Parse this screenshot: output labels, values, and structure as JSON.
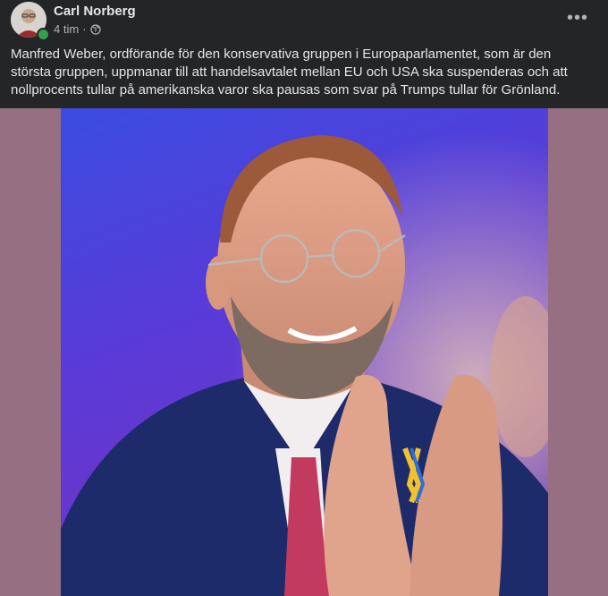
{
  "post": {
    "author": "Carl Norberg",
    "timestamp": "4 tim",
    "separator": "·",
    "audience_icon": "globe-icon",
    "more_icon": "more-horizontal-icon",
    "more_label": "•••",
    "text": "Manfred Weber, ordförande för den konservativa gruppen i Europaparlamentet, som är den största gruppen, uppmanar till att handelsavtalet mellan EU och USA ska suspenderas och att nollprocents tullar på amerikanska varor ska pausas som svar på Trumps tullar för Grönland.",
    "online": true
  },
  "colors": {
    "background": "#242526",
    "text_primary": "#e4e6eb",
    "text_secondary": "#b0b3b8",
    "online_green": "#31a24c",
    "media_letterbox": "#966f82"
  }
}
